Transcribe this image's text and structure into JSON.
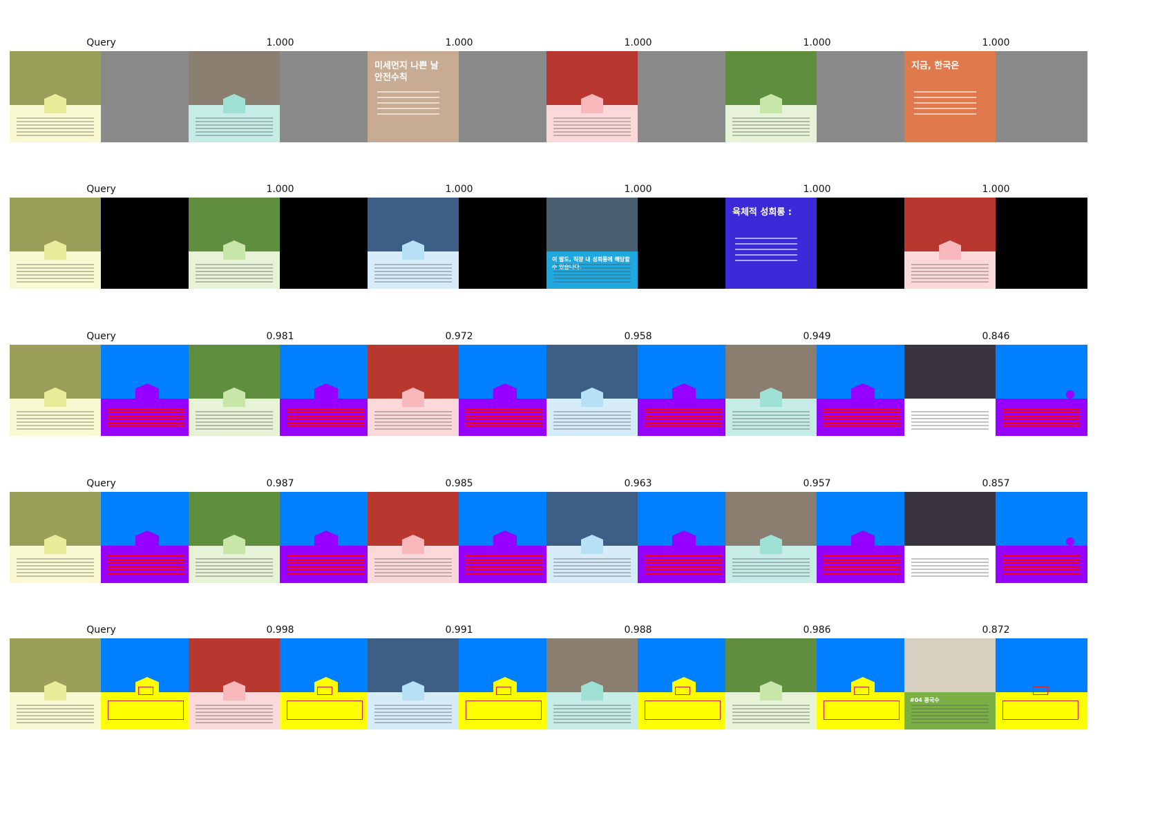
{
  "colors": {
    "gray_mask": "#8a8a8a",
    "black_mask": "#000000",
    "blue": "#0080ff",
    "purple": "#9500ff",
    "yellow": "#ffff00",
    "red": "#ff0000"
  },
  "rows": [
    {
      "mask_type": "gray",
      "cells": [
        {
          "title": "Query",
          "thumb": "mungbeans"
        },
        {
          "title": "1.000",
          "thumb": "clams"
        },
        {
          "title": "1.000",
          "thumb": "finedust",
          "text_lines": [
            "미세먼지 나쁜 날",
            "안전수칙"
          ]
        },
        {
          "title": "1.000",
          "thumb": "strawberry"
        },
        {
          "title": "1.000",
          "thumb": "greens"
        },
        {
          "title": "1.000",
          "thumb": "orange",
          "text_lines": [
            "지금, 한국은"
          ]
        }
      ]
    },
    {
      "mask_type": "black",
      "cells": [
        {
          "title": "Query",
          "thumb": "mungbeans"
        },
        {
          "title": "1.000",
          "thumb": "greens"
        },
        {
          "title": "1.000",
          "thumb": "tuna"
        },
        {
          "title": "1.000",
          "thumb": "office",
          "text_lines": [
            "이 발도, 직장 내 성희롱에 해당할 수 있습니다."
          ]
        },
        {
          "title": "1.000",
          "thumb": "harassment",
          "text_lines": [
            "육체적 성희롱 :"
          ]
        },
        {
          "title": "1.000",
          "thumb": "strawberry"
        }
      ]
    },
    {
      "mask_type": "bluepurple",
      "cells": [
        {
          "title": "Query",
          "thumb": "mungbeans"
        },
        {
          "title": "0.981",
          "thumb": "greens"
        },
        {
          "title": "0.972",
          "thumb": "strawberry"
        },
        {
          "title": "0.958",
          "thumb": "tuna"
        },
        {
          "title": "0.949",
          "thumb": "clams"
        },
        {
          "title": "0.846",
          "thumb": "bridge",
          "mask_variant": "dot"
        }
      ]
    },
    {
      "mask_type": "bluepurple",
      "cells": [
        {
          "title": "Query",
          "thumb": "mungbeans"
        },
        {
          "title": "0.987",
          "thumb": "greens"
        },
        {
          "title": "0.985",
          "thumb": "strawberry"
        },
        {
          "title": "0.963",
          "thumb": "tuna"
        },
        {
          "title": "0.957",
          "thumb": "clams"
        },
        {
          "title": "0.857",
          "thumb": "bridge",
          "mask_variant": "dot"
        }
      ]
    },
    {
      "mask_type": "blueyellow",
      "cells": [
        {
          "title": "Query",
          "thumb": "mungbeans"
        },
        {
          "title": "0.998",
          "thumb": "strawberry"
        },
        {
          "title": "0.991",
          "thumb": "tuna"
        },
        {
          "title": "0.988",
          "thumb": "clams"
        },
        {
          "title": "0.986",
          "thumb": "greens"
        },
        {
          "title": "0.872",
          "thumb": "noodle",
          "mask_variant": "nohex",
          "text_lines": [
            "#04 콩국수"
          ]
        }
      ]
    }
  ],
  "thumb_styles": {
    "mungbeans": {
      "photo": "#9aa05a",
      "panel": "#fafad2",
      "hex": "#e8ec9a"
    },
    "clams": {
      "photo": "#8a7e70",
      "panel": "#c6ece6",
      "hex": "#9fe0d4"
    },
    "strawberry": {
      "photo": "#b8372e",
      "panel": "#fbd9da",
      "hex": "#f7b7bb"
    },
    "greens": {
      "photo": "#5f8f3e",
      "panel": "#e6f3d6",
      "hex": "#c8e6a8"
    },
    "tuna": {
      "photo": "#3d5f86",
      "panel": "#d6edf9",
      "hex": "#b6e0f5"
    },
    "finedust": {
      "full": "#c7ab92"
    },
    "orange": {
      "full": "#e07a4c"
    },
    "office": {
      "photo": "#4a6070",
      "panel": "#1fa8e0",
      "hex": ""
    },
    "harassment": {
      "full": "#3a2ad8"
    },
    "bridge": {
      "photo": "#3a3440",
      "panel": "#ffffff",
      "hex": ""
    },
    "noodle": {
      "photo": "#d9cfc0",
      "panel": "#7bb045",
      "hex": ""
    }
  }
}
